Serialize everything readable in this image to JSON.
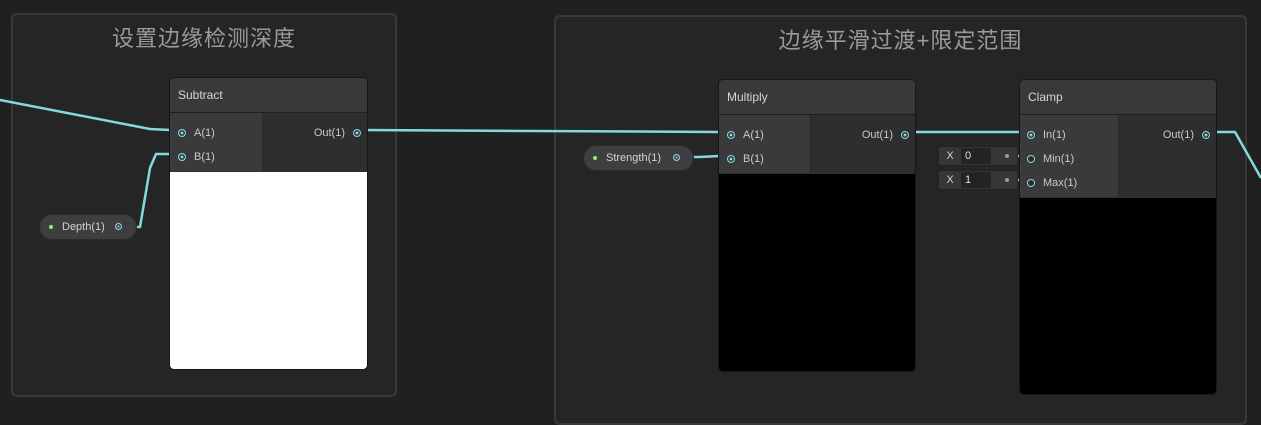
{
  "groups": [
    {
      "title": "设置边缘检测深度"
    },
    {
      "title": "边缘平滑过渡+限定范围"
    }
  ],
  "nodes": {
    "subtract": {
      "title": "Subtract",
      "inputs": [
        "A(1)",
        "B(1)"
      ],
      "output": "Out(1)",
      "preview": "white"
    },
    "multiply": {
      "title": "Multiply",
      "inputs": [
        "A(1)",
        "B(1)"
      ],
      "output": "Out(1)",
      "preview": "black"
    },
    "clamp": {
      "title": "Clamp",
      "inputs": [
        "In(1)",
        "Min(1)",
        "Max(1)"
      ],
      "output": "Out(1)",
      "preview": "black"
    }
  },
  "properties": {
    "depth": {
      "label": "Depth(1)"
    },
    "strength": {
      "label": "Strength(1)"
    }
  },
  "inline_fields": {
    "min": {
      "axis": "X",
      "value": "0"
    },
    "max": {
      "axis": "X",
      "value": "1"
    }
  },
  "colors": {
    "wire": "#84d9dd",
    "property_dot": "#9ee27f",
    "background": "#202020"
  }
}
